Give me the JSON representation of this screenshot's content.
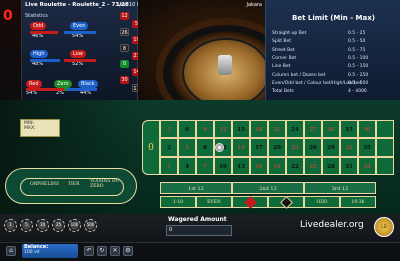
{
  "window": {
    "title": "Live Roulette - Roulette_2 - 73/28",
    "dealer_label": "Jakara"
  },
  "last_number": "0",
  "statistics": {
    "title": "Statistics",
    "odd_label": "Odd",
    "odd_pct": "46%",
    "even_label": "Even",
    "even_pct": "54%",
    "high_label": "High",
    "high_pct": "48%",
    "low_label": "Low",
    "low_pct": "52%",
    "red_label": "Red",
    "red_pct": "54%",
    "zero_label": "Zero",
    "zero_pct": "2%",
    "black_label": "Black",
    "black_pct": "44%"
  },
  "last_results": {
    "title": "Last 10 Results",
    "items": [
      {
        "n": "12",
        "c": "r"
      },
      {
        "n": "5",
        "c": "r"
      },
      {
        "n": "26",
        "c": "b"
      },
      {
        "n": "19",
        "c": "r"
      },
      {
        "n": "8",
        "c": "b"
      },
      {
        "n": "21",
        "c": "r"
      },
      {
        "n": "0",
        "c": "g"
      },
      {
        "n": "14",
        "c": "r"
      },
      {
        "n": "30",
        "c": "r"
      },
      {
        "n": "17",
        "c": "b"
      }
    ]
  },
  "bet_limit": {
    "title": "Bet Limit (Min - Max)",
    "rows": [
      {
        "k": "Straight-up Bet",
        "v": "0.5 - 25"
      },
      {
        "k": "Split Bet",
        "v": "0.5 - 50"
      },
      {
        "k": "Street Bet",
        "v": "0.5 - 75"
      },
      {
        "k": "Corner Bet",
        "v": "0.5 - 100"
      },
      {
        "k": "Line Bet",
        "v": "0.5 - 150"
      },
      {
        "k": "Column bet / Dozen bet",
        "v": "0.5 - 250"
      },
      {
        "k": "Even/Odd bet / Colour bet/High/Low bet",
        "v": "0.5 - 500"
      },
      {
        "k": "Total Bets",
        "v": "4 - 4000"
      }
    ]
  },
  "chip_info": {
    "line1": "MIN:",
    "line2": "MAX:"
  },
  "racetrack": {
    "words": [
      "ORPHELINS",
      "TIER",
      "VOISINS DU ZERO"
    ]
  },
  "table": {
    "zero": "0",
    "rows": [
      [
        "3",
        "6",
        "9",
        "12",
        "15",
        "18",
        "21",
        "24",
        "27",
        "30",
        "33",
        "36"
      ],
      [
        "2",
        "5",
        "8",
        "11",
        "14",
        "17",
        "20",
        "23",
        "26",
        "29",
        "32",
        "35"
      ],
      [
        "1",
        "4",
        "7",
        "10",
        "13",
        "16",
        "19",
        "22",
        "25",
        "28",
        "31",
        "34"
      ]
    ],
    "reds": [
      "1",
      "3",
      "5",
      "7",
      "9",
      "12",
      "14",
      "16",
      "18",
      "19",
      "21",
      "23",
      "25",
      "27",
      "30",
      "32",
      "34",
      "36"
    ],
    "dozens": [
      "1st 12",
      "2nd 12",
      "3rd 12"
    ],
    "outside": [
      "1-18",
      "EVEN",
      "",
      "",
      "ODD",
      "19-36"
    ],
    "colors": {
      "felt": "#0f6a3a",
      "red": "#c41b1b",
      "black": "#111111"
    }
  },
  "chips": [
    "1",
    "5",
    "10",
    "25",
    "100",
    "500"
  ],
  "wager": {
    "label": "Wagered Amount",
    "value": "0"
  },
  "brand": {
    "name": "Livedealer.org",
    "logo_text": "LD"
  },
  "footer": {
    "balance_label": "Balance:",
    "balance_value": "100 vd"
  }
}
